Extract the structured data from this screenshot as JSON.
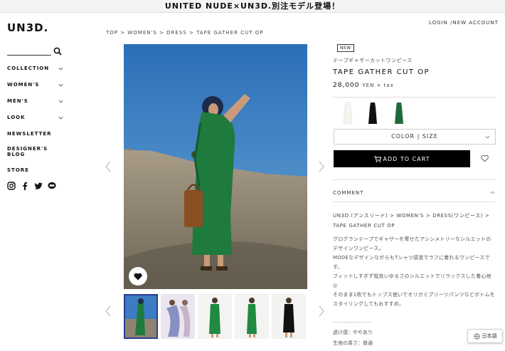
{
  "banner": {
    "text": "UNITED NUDE×UN3D.別注モデル登場！"
  },
  "header": {
    "logo": "UN3D.",
    "login": "LOGIN",
    "new_account": "/NEW ACCOUNT"
  },
  "breadcrumb": {
    "items": [
      "TOP",
      "WOMEN'S",
      "DRESS",
      "TAPE GATHER CUT OP"
    ],
    "separator": " > "
  },
  "sidebar": {
    "nav": [
      {
        "label": "COLLECTION",
        "has_submenu": true
      },
      {
        "label": "WOMEN'S",
        "has_submenu": true
      },
      {
        "label": "MEN'S",
        "has_submenu": true
      },
      {
        "label": "LOOK",
        "has_submenu": true
      },
      {
        "label": "NEWSLETTER",
        "has_submenu": false
      },
      {
        "label": "DESIGNER'S BLOG",
        "has_submenu": false
      },
      {
        "label": "STORE",
        "has_submenu": false
      }
    ],
    "social_icons": [
      "instagram-icon",
      "facebook-icon",
      "twitter-icon",
      "line-icon"
    ]
  },
  "product": {
    "badge": "NEW",
    "name_jp": "テープギャザーカットワンピース",
    "name_en": "TAPE GATHER CUT OP",
    "price": "28,000",
    "price_suffix": "YEN + tax",
    "colors": [
      "#f6f4ee",
      "#111111",
      "#1f6a3c"
    ],
    "variant_select": "COLOR | SIZE",
    "add_to_cart": "ADD TO CART",
    "thumbnails_count": 5
  },
  "comment": {
    "label": "COMMENT",
    "category_path": "UN3D.(アンスリード) > WOMEN'S > DRESS(ワンピース) > TAPE GATHER CUT OP",
    "description": [
      "グログランテープでギャザーを寄せたアシンメトリーなシルエットのデザインワンピース。",
      "MODEなデザインながらもTシャツ感覚でラフに着れるワンピースです。",
      "フィットしすぎず程良いゆるさのシルエットでリラックスした着心地◎",
      "そのまま1枚でもトップス使いでオリガミプリーツパンツなどボトムをスタイリングしてもおすすめ。"
    ],
    "dashes": "------------------",
    "specs": [
      "透け感：ややあり",
      "生地の厚さ：普通"
    ]
  },
  "language": {
    "label": "日本語"
  }
}
